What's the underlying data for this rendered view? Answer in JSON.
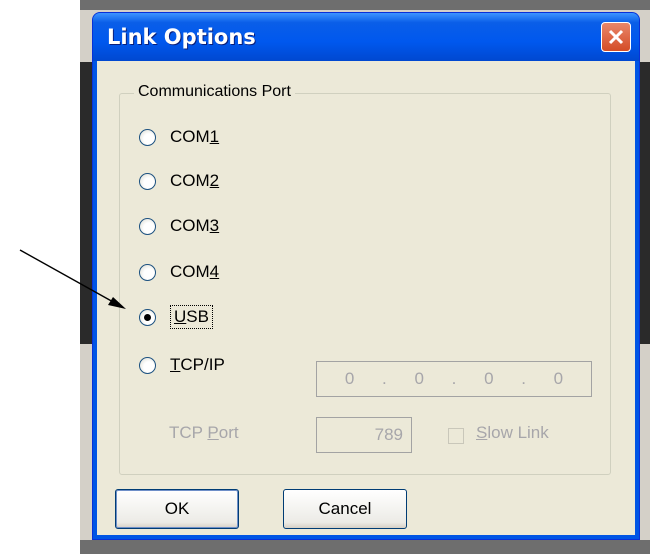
{
  "dialog": {
    "title": "Link Options",
    "group_title": "Communications Port",
    "ports": [
      {
        "label": "COM",
        "mnemonic": "1",
        "checked": false
      },
      {
        "label": "COM",
        "mnemonic": "2",
        "checked": false
      },
      {
        "label": "COM",
        "mnemonic": "3",
        "checked": false
      },
      {
        "label": "COM",
        "mnemonic": "4",
        "checked": false
      },
      {
        "mnemonic": "U",
        "rest": "SB",
        "checked": true
      },
      {
        "mnemonic": "T",
        "rest": "CP/IP",
        "checked": false
      }
    ],
    "ip_address": [
      "0",
      ".",
      "0",
      ".",
      "0",
      ".",
      "0"
    ],
    "tcp_port_label_prefix": "TCP ",
    "tcp_port_label_mnemonic": "P",
    "tcp_port_label_rest": "ort",
    "tcp_port_value": "789",
    "slow_link_mnemonic": "S",
    "slow_link_rest": "low Link",
    "ok_label": "OK",
    "cancel_label": "Cancel"
  },
  "colors": {
    "titlebar": "#0058ee",
    "client": "#ece9d8",
    "disabled_text": "#a7a6aa",
    "close_button": "#d44d26"
  }
}
